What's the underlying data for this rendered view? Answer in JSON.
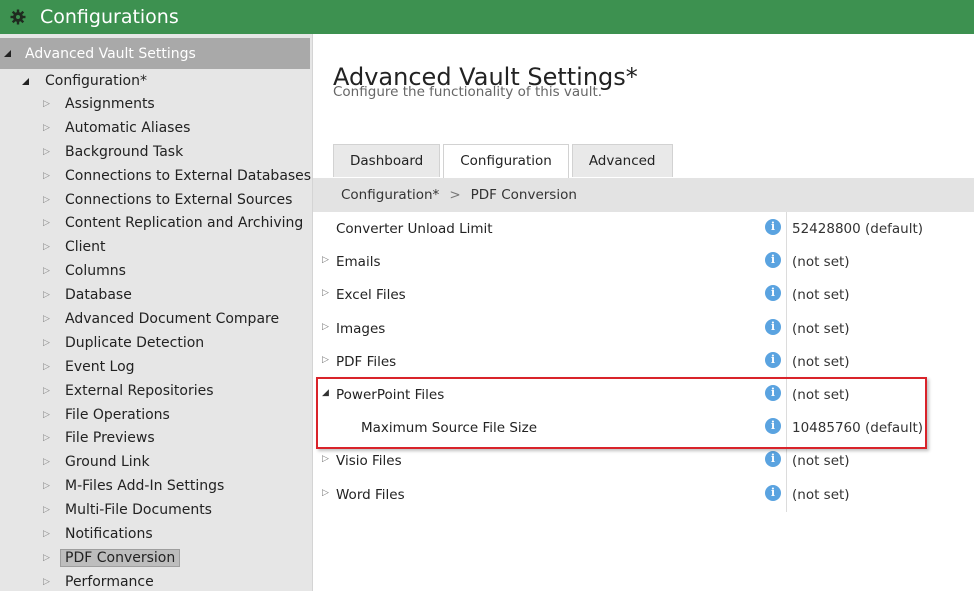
{
  "app": {
    "title": "Configurations",
    "title_icon": "gear-icon",
    "accent_color": "#3d9150"
  },
  "sidebar": {
    "root_label": "Advanced Vault Settings",
    "config_label": "Configuration*",
    "items": [
      {
        "label": "Assignments"
      },
      {
        "label": "Automatic Aliases"
      },
      {
        "label": "Background Task"
      },
      {
        "label": "Connections to External Databases"
      },
      {
        "label": "Connections to External Sources"
      },
      {
        "label": "Content Replication and Archiving"
      },
      {
        "label": "Client"
      },
      {
        "label": "Columns"
      },
      {
        "label": "Database"
      },
      {
        "label": "Advanced Document Compare"
      },
      {
        "label": "Duplicate Detection"
      },
      {
        "label": "Event Log"
      },
      {
        "label": "External Repositories"
      },
      {
        "label": "File Operations"
      },
      {
        "label": "File Previews"
      },
      {
        "label": "Ground Link"
      },
      {
        "label": "M-Files Add-In Settings"
      },
      {
        "label": "Multi-File Documents"
      },
      {
        "label": "Notifications"
      },
      {
        "label": "PDF Conversion",
        "selected": true
      },
      {
        "label": "Performance"
      }
    ]
  },
  "main": {
    "title": "Advanced Vault Settings*",
    "subtitle": "Configure the functionality of this vault.",
    "tabs": [
      {
        "label": "Dashboard"
      },
      {
        "label": "Configuration",
        "active": true
      },
      {
        "label": "Advanced"
      }
    ],
    "breadcrumb": {
      "root": "Configuration*",
      "separator": ">",
      "current": "PDF Conversion"
    },
    "rows": [
      {
        "name": "Converter Unload Limit",
        "value": "52428800 (default)",
        "expander": "none",
        "child": false
      },
      {
        "name": "Emails",
        "value": "(not set)",
        "expander": "collapsed",
        "child": false
      },
      {
        "name": "Excel Files",
        "value": "(not set)",
        "expander": "collapsed",
        "child": false
      },
      {
        "name": "Images",
        "value": "(not set)",
        "expander": "collapsed",
        "child": false
      },
      {
        "name": "PDF Files",
        "value": "(not set)",
        "expander": "collapsed",
        "child": false
      },
      {
        "name": "PowerPoint Files",
        "value": "(not set)",
        "expander": "expanded",
        "child": false
      },
      {
        "name": "Maximum Source File Size",
        "value": "10485760 (default)",
        "expander": "none",
        "child": true
      },
      {
        "name": "Visio Files",
        "value": "(not set)",
        "expander": "collapsed",
        "child": false
      },
      {
        "name": "Word Files",
        "value": "(not set)",
        "expander": "collapsed",
        "child": false
      }
    ],
    "info_glyph": "i",
    "highlight_color": "#d9232a"
  }
}
